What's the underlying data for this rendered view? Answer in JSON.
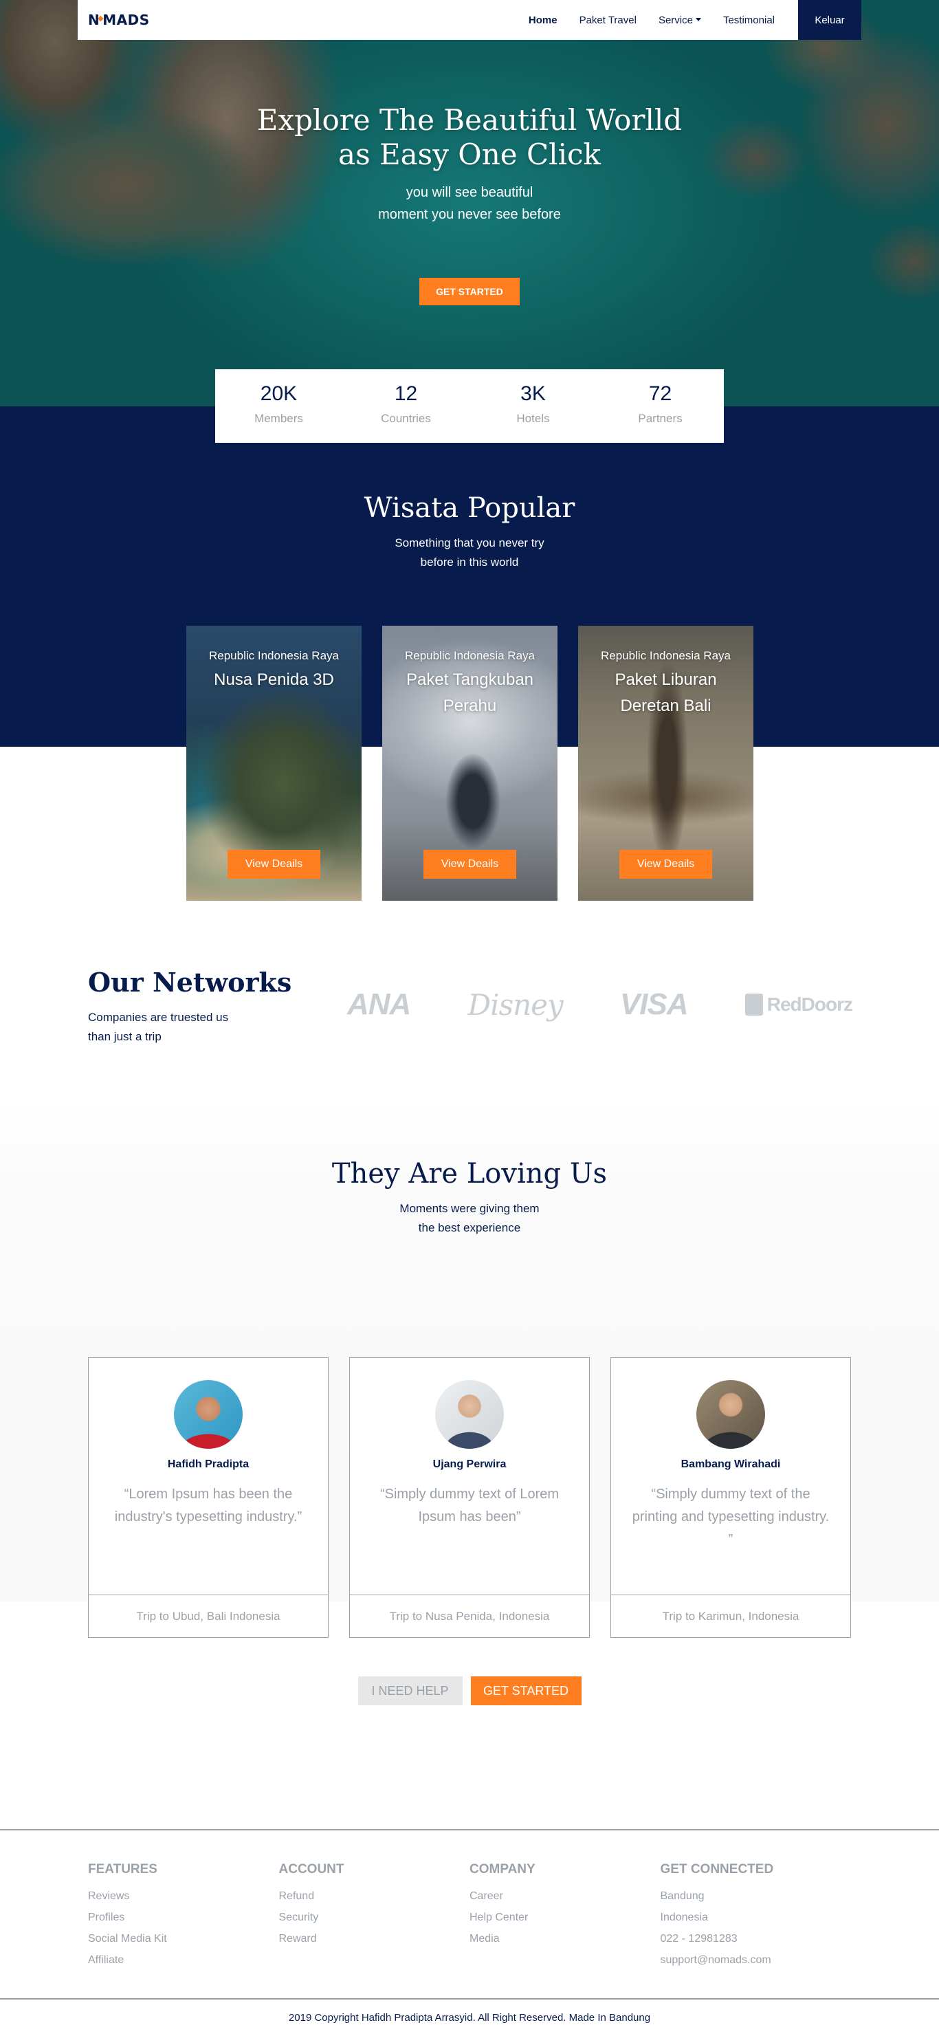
{
  "navbar": {
    "brand": {
      "before": "N",
      "accent": "◆",
      "after": "MADS"
    },
    "links": [
      {
        "label": "Home",
        "active": true
      },
      {
        "label": "Paket Travel"
      },
      {
        "label": "Service"
      },
      {
        "label": "Testimonial"
      }
    ],
    "logout_label": "Keluar"
  },
  "hero": {
    "title_line1": "Explore The Beautiful Worlld",
    "title_line2": "as Easy One Click",
    "subtitle_line1": "you will see beautiful",
    "subtitle_line2": "moment you never see before",
    "cta_label": "GET STARTED"
  },
  "stats": [
    {
      "value": "20K",
      "label": "Members"
    },
    {
      "value": "12",
      "label": "Countries"
    },
    {
      "value": "3K",
      "label": "Hotels"
    },
    {
      "value": "72",
      "label": "Partners"
    }
  ],
  "popular": {
    "title": "Wisata Popular",
    "subtitle_line1": "Something that you never try",
    "subtitle_line2": "before in this world",
    "cards": [
      {
        "country": "Republic Indonesia Raya",
        "title": "Nusa Penida 3D",
        "button": "View Deails"
      },
      {
        "country": "Republic Indonesia Raya",
        "title": "Paket Tangkuban Perahu",
        "button": "View Deails"
      },
      {
        "country": "Republic Indonesia Raya",
        "title": "Paket Liburan Deretan Bali",
        "button": "View Deails"
      }
    ]
  },
  "networks": {
    "title": "Our Networks",
    "subtitle_line1": "Companies are truested us",
    "subtitle_line2": "than just a trip",
    "partners": [
      "ANA",
      "Disney",
      "VISA",
      "RedDoorz"
    ]
  },
  "testimonial": {
    "title": "They Are Loving Us",
    "subtitle_line1": "Moments were giving them",
    "subtitle_line2": "the best experience",
    "items": [
      {
        "name": "Hafidh Pradipta",
        "quote": "“Lorem Ipsum has been the industry's typesetting industry.”",
        "trip": "Trip to Ubud, Bali Indonesia"
      },
      {
        "name": "Ujang Perwira",
        "quote": "“Simply dummy text of Lorem Ipsum has been”",
        "trip": "Trip to Nusa Penida, Indonesia"
      },
      {
        "name": "Bambang Wirahadi",
        "quote": "“Simply dummy text of the printing and typesetting industry. ”",
        "trip": "Trip to Karimun, Indonesia"
      }
    ],
    "help_label": "I NEED HELP",
    "start_label": "GET STARTED"
  },
  "footer": {
    "columns": [
      {
        "heading": "FEATURES",
        "links": [
          "Reviews",
          "Profiles",
          "Social Media Kit",
          "Affiliate"
        ]
      },
      {
        "heading": "ACCOUNT",
        "links": [
          "Refund",
          "Security",
          "Reward"
        ]
      },
      {
        "heading": "COMPANY",
        "links": [
          "Career",
          "Help Center",
          "Media"
        ]
      },
      {
        "heading": "GET CONNECTED",
        "links": [
          "Bandung",
          "Indonesia",
          "022 - 12981283",
          "support@nomads.com"
        ]
      }
    ],
    "copyright": "2019 Copyright Hafidh Pradipta Arrasyid. All Right Reserved. Made In Bandung"
  },
  "colors": {
    "navy": "#071c4d",
    "orange": "#ff7e1f",
    "muted": "#9aa1a9"
  }
}
